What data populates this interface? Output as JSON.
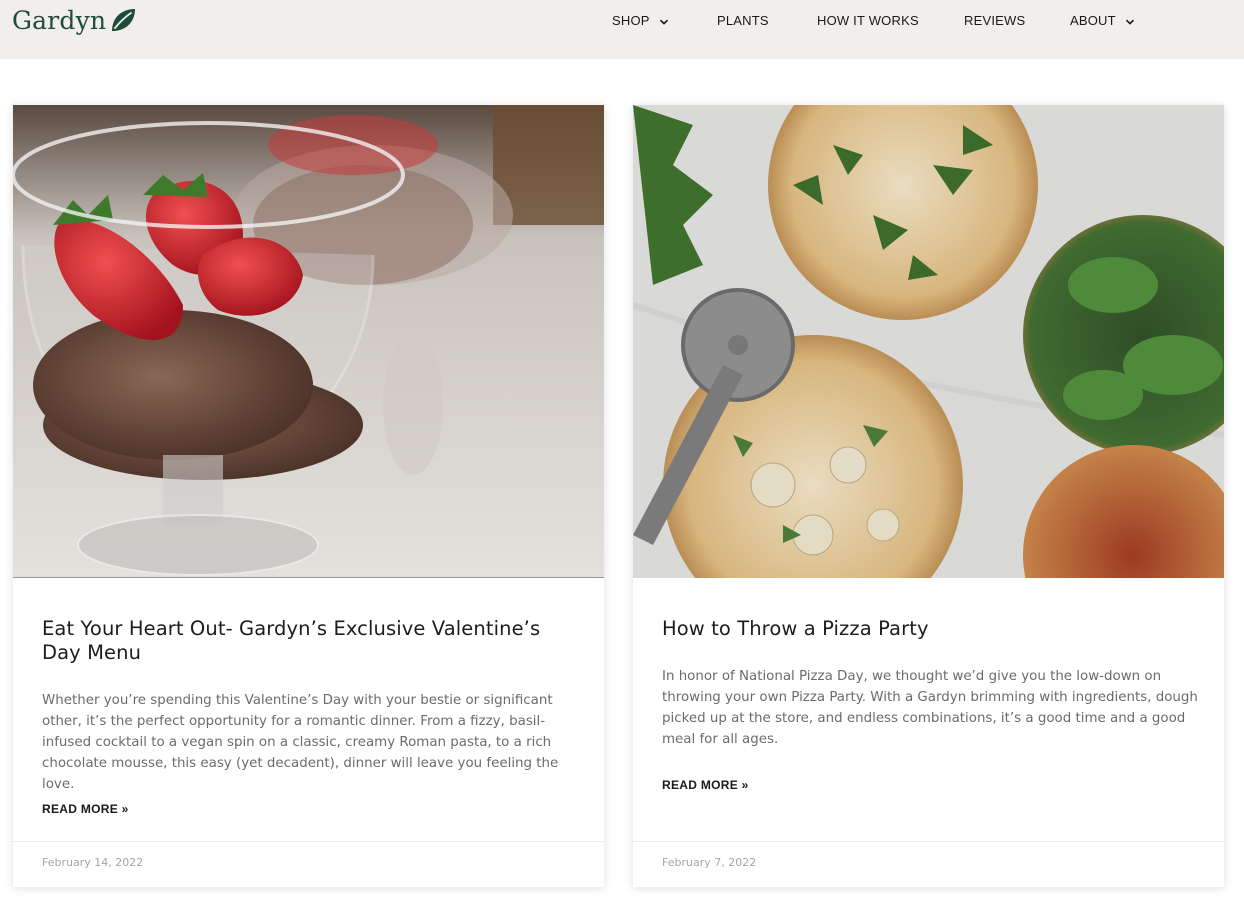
{
  "header": {
    "logo_text": "Gardyn",
    "nav": [
      {
        "label": "SHOP",
        "has_dropdown": true
      },
      {
        "label": "PLANTS",
        "has_dropdown": false
      },
      {
        "label": "HOW IT WORKS",
        "has_dropdown": false
      },
      {
        "label": "REVIEWS",
        "has_dropdown": false
      },
      {
        "label": "ABOUT",
        "has_dropdown": true
      }
    ]
  },
  "posts": [
    {
      "image_subject": "chocolate-mousse-with-strawberries",
      "title": "Eat Your Heart Out- Gardyn’s Exclusive Valentine’s Day Menu",
      "excerpt": "Whether you’re spending this Valentine’s Day with your bestie or significant other, it’s the perfect opportunity for a romantic dinner. From a fizzy, basil-infused cocktail to a vegan spin on a classic, creamy Roman pasta, to a rich chocolate mousse, this easy (yet decadent), dinner will leave you feeling the love.",
      "read_more": "READ MORE »",
      "date": "February 14, 2022"
    },
    {
      "image_subject": "pizzas-with-greens-and-pizza-cutter",
      "title": "How to Throw a Pizza Party",
      "excerpt": "In honor of National Pizza Day, we thought we’d give you the low-down on throwing your own Pizza Party. With a Gardyn brimming with ingredients, dough picked up at the store, and endless combinations, it’s a good time and a good meal for all ages.",
      "read_more": "READ MORE »",
      "date": "February 7, 2022"
    }
  ],
  "colors": {
    "header_bg": "#f1eeeb",
    "brand_green": "#1f4b3c",
    "title_text": "#1c1c1c",
    "excerpt_text": "#6b6b6b",
    "date_text": "#a5a5a5"
  }
}
